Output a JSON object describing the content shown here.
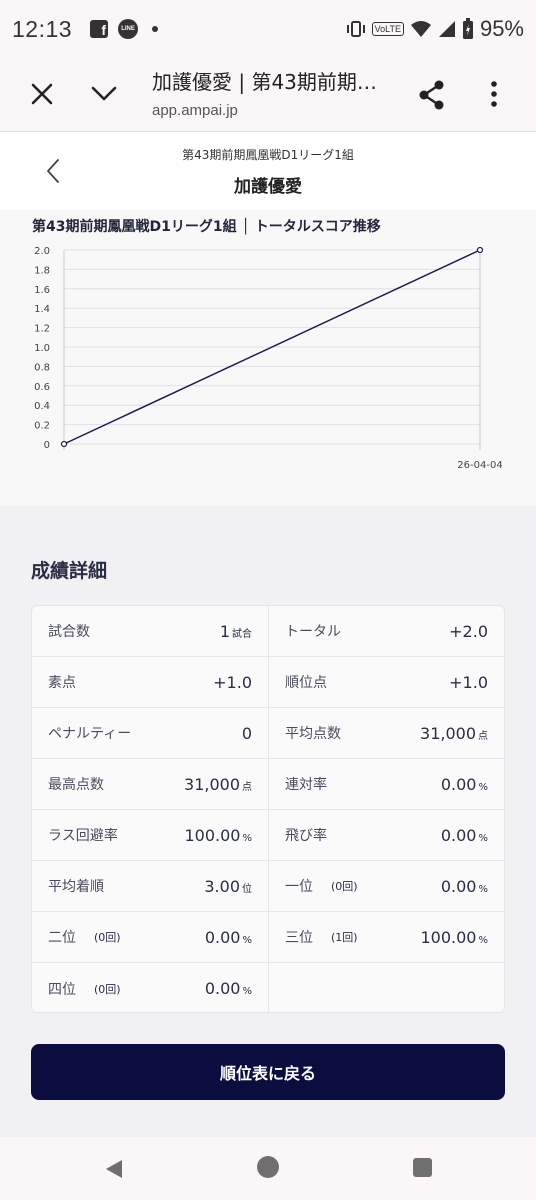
{
  "status_bar": {
    "time": "12:13",
    "facebook_icon": "f",
    "line_icon": "LINE",
    "volte": "VoLTE",
    "battery": "95%"
  },
  "browser": {
    "title": "加護優愛 | 第43期前期…",
    "url": "app.ampai.jp"
  },
  "header": {
    "subtitle": "第43期前期鳳凰戦D1リーグ1組",
    "title": "加護優愛"
  },
  "chart_data": {
    "type": "line",
    "title": "第43期前期鳳凰戦D1リーグ1組 │ トータルスコア推移",
    "x": [
      "",
      "26-04-04"
    ],
    "series": [
      {
        "values": [
          0,
          2.0
        ]
      }
    ],
    "ylim": [
      0,
      2.0
    ],
    "yticks": [
      "0",
      "0.2",
      "0.4",
      "0.6",
      "0.8",
      "1.0",
      "1.2",
      "1.4",
      "1.6",
      "1.8",
      "2.0"
    ],
    "grid": true,
    "line_color": "#1d1f4a"
  },
  "stats": {
    "title": "成績詳細",
    "rows": [
      [
        {
          "label": "試合数",
          "value": "1",
          "unit": "試合"
        },
        {
          "label": "トータル",
          "value": "+2.0"
        }
      ],
      [
        {
          "label": "素点",
          "value": "+1.0"
        },
        {
          "label": "順位点",
          "value": "+1.0"
        }
      ],
      [
        {
          "label": "ペナルティー",
          "value": "0"
        },
        {
          "label": "平均点数",
          "value": "31,000",
          "unit": "点"
        }
      ],
      [
        {
          "label": "最高点数",
          "value": "31,000",
          "unit": "点"
        },
        {
          "label": "連対率",
          "value": "0.00",
          "unit": "%"
        }
      ],
      [
        {
          "label": "ラス回避率",
          "value": "100.00",
          "unit": "%"
        },
        {
          "label": "飛び率",
          "value": "0.00",
          "unit": "%"
        }
      ],
      [
        {
          "label": "平均着順",
          "value": "3.00",
          "unit": "位"
        },
        {
          "label": "一位",
          "count": "(0回)",
          "value": "0.00",
          "unit": "%"
        }
      ],
      [
        {
          "label": "二位",
          "count": "(0回)",
          "value": "0.00",
          "unit": "%"
        },
        {
          "label": "三位",
          "count": "(1回)",
          "value": "100.00",
          "unit": "%"
        }
      ],
      [
        {
          "label": "四位",
          "count": "(0回)",
          "value": "0.00",
          "unit": "%"
        },
        null
      ]
    ]
  },
  "back_button": {
    "label": "順位表に戻る"
  },
  "colors": {
    "accent": "#0b0d3f"
  }
}
